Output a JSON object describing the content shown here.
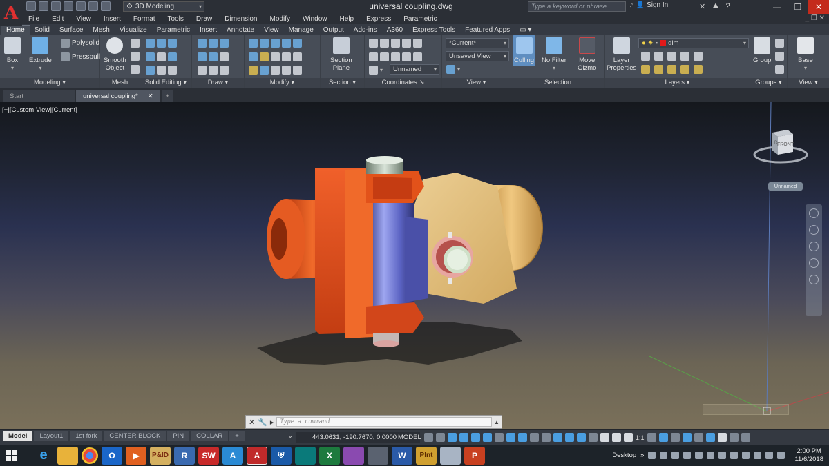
{
  "app": {
    "title": "universal coupling.dwg",
    "workspace": "3D Modeling",
    "search_placeholder": "Type a keyword or phrase",
    "sign_in": "Sign In"
  },
  "menu": [
    "File",
    "Edit",
    "View",
    "Insert",
    "Format",
    "Tools",
    "Draw",
    "Dimension",
    "Modify",
    "Window",
    "Help",
    "Express",
    "Parametric"
  ],
  "ribbon_tabs": [
    "Home",
    "Solid",
    "Surface",
    "Mesh",
    "Visualize",
    "Parametric",
    "Insert",
    "Annotate",
    "View",
    "Manage",
    "Output",
    "Add-ins",
    "A360",
    "Express Tools",
    "Featured Apps"
  ],
  "ribbon": {
    "box": "Box",
    "extrude": "Extrude",
    "polysolid": "Polysolid",
    "presspull": "Presspull",
    "smooth_object": [
      "Smooth",
      "Object"
    ],
    "section_plane": [
      "Section",
      "Plane"
    ],
    "current_combo": "*Current*",
    "unsaved_view": "Unsaved View",
    "unnamed_combo": "Unnamed",
    "culling": "Culling",
    "no_filter": "No Filter",
    "move_gizmo": [
      "Move",
      "Gizmo"
    ],
    "layer_properties": [
      "Layer",
      "Properties"
    ],
    "layer_combo": "dim",
    "group": "Group",
    "base": "Base",
    "panels": {
      "modeling": "Modeling",
      "mesh": "Mesh",
      "solid_editing": "Solid Editing",
      "draw": "Draw",
      "modify": "Modify",
      "section": "Section",
      "coordinates": "Coordinates",
      "view": "View",
      "selection": "Selection",
      "layers": "Layers",
      "groups": "Groups",
      "view2": "View"
    }
  },
  "file_tabs": [
    "Start",
    "universal coupling*"
  ],
  "viewport": {
    "label": "[−][Custom View][Current]",
    "viewcube_face": "FRONT",
    "ucs_name": "Unnamed",
    "command_placeholder": "Type a command"
  },
  "status": {
    "layout_tabs": [
      "Model",
      "Layout1",
      "1st fork",
      "CENTER BLOCK",
      "PIN",
      "COLLAR"
    ],
    "coords": "443.0631, -190.7670, 0.0000",
    "model": "MODEL",
    "scale": "1:1"
  },
  "taskbar": {
    "desktop": "Desktop",
    "time": "2:00 PM",
    "date": "11/6/2018"
  },
  "colors": {
    "accent_red": "#e03030",
    "orange_part": "#e8501a",
    "gold_part": "#d9a953",
    "blue_pin": "#7a86d6"
  }
}
